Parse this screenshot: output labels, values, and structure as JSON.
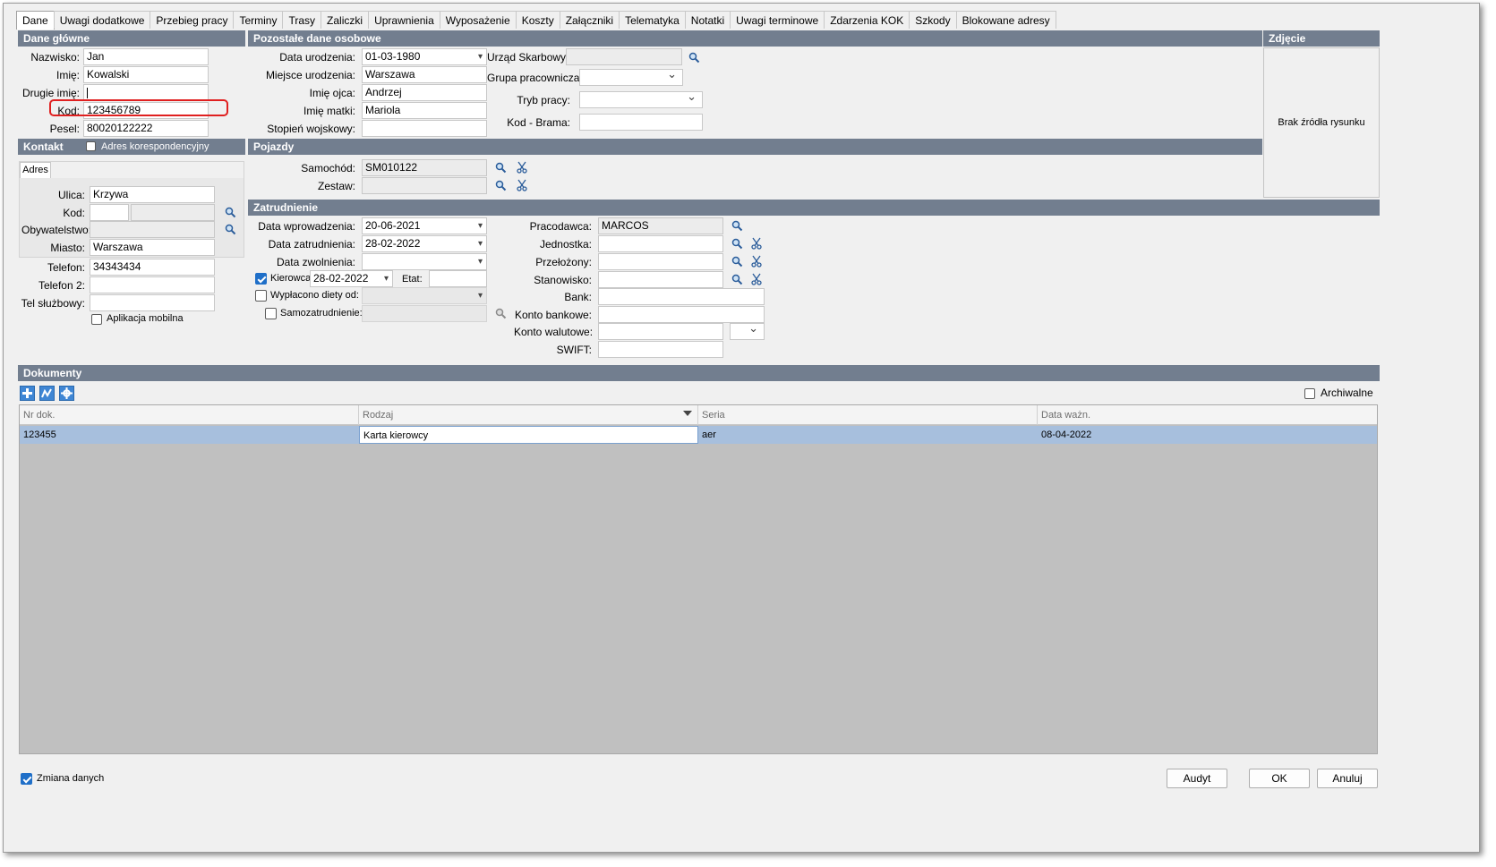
{
  "tabs": [
    "Dane",
    "Uwagi dodatkowe",
    "Przebieg pracy",
    "Terminy",
    "Trasy",
    "Zaliczki",
    "Uprawnienia",
    "Wyposażenie",
    "Koszty",
    "Załączniki",
    "Telematyka",
    "Notatki",
    "Uwagi terminowe",
    "Zdarzenia KOK",
    "Szkody",
    "Blokowane adresy"
  ],
  "sections": {
    "main": "Dane główne",
    "other": "Pozostałe dane osobowe",
    "photo": "Zdjęcie",
    "contact": "Kontakt",
    "vehicles": "Pojazdy",
    "employment": "Zatrudnienie",
    "documents": "Dokumenty"
  },
  "main": {
    "surname_label": "Nazwisko:",
    "surname": "Jan",
    "name_label": "Imię:",
    "name": "Kowalski",
    "second_name_label": "Drugie imię:",
    "second_name": "",
    "code_label": "Kod:",
    "code": "123456789",
    "pesel_label": "Pesel:",
    "pesel": "80020122222"
  },
  "other": {
    "birth_date_label": "Data urodzenia:",
    "birth_date": "01-03-1980",
    "birth_place_label": "Miejsce urodzenia:",
    "birth_place": "Warszawa",
    "father_label": "Imię ojca:",
    "father": "Andrzej",
    "mother_label": "Imię matki:",
    "mother": "Mariola",
    "military_label": "Stopień wojskowy:",
    "military": "",
    "tax_office_label": "Urząd Skarbowy:",
    "tax_office": "",
    "worker_group_label": "Grupa pracownicza:",
    "worker_group": "",
    "work_mode_label": "Tryb pracy:",
    "work_mode": "",
    "gate_code_label": "Kod - Brama:",
    "gate_code": ""
  },
  "photo": {
    "empty_text": "Brak źródła rysunku"
  },
  "contact": {
    "corr_address_label": "Adres korespondencyjny",
    "address_tab": "Adres",
    "street_label": "Ulica:",
    "street": "Krzywa",
    "postal_label": "Kod:",
    "postal": "",
    "postal_city": "",
    "citizenship_label": "Obywatelstwo:",
    "citizenship": "",
    "city_label": "Miasto:",
    "city": "Warszawa",
    "phone_label": "Telefon:",
    "phone": "34343434",
    "phone2_label": "Telefon 2:",
    "phone2": "",
    "work_phone_label": "Tel służbowy:",
    "work_phone": "",
    "mobile_app_label": "Aplikacja mobilna"
  },
  "vehicles": {
    "car_label": "Samochód:",
    "car": "SM010122",
    "set_label": "Zestaw:",
    "set": ""
  },
  "employment": {
    "intro_date_label": "Data wprowadzenia:",
    "intro_date": "20-06-2021",
    "hire_date_label": "Data zatrudnienia:",
    "hire_date": "28-02-2022",
    "release_date_label": "Data zwolnienia:",
    "release_date": "",
    "driver_label": "Kierowca",
    "driver_date": "28-02-2022",
    "etat_label": "Etat:",
    "etat": "",
    "diety_label": "Wypłacono diety od:",
    "diety": "",
    "self_label": "Samozatrudnienie:",
    "self": "",
    "employer_label": "Pracodawca:",
    "employer": "MARCOS",
    "unit_label": "Jednostka:",
    "unit": "",
    "supervisor_label": "Przełożony:",
    "supervisor": "",
    "position_label": "Stanowisko:",
    "position": "",
    "bank_label": "Bank:",
    "bank": "",
    "account_label": "Konto bankowe:",
    "account": "",
    "fx_account_label": "Konto walutowe:",
    "fx_account": "",
    "currency": "",
    "swift_label": "SWIFT:",
    "swift": ""
  },
  "documents": {
    "archived_label": "Archiwalne",
    "columns": [
      "Nr dok.",
      "Rodzaj",
      "Seria",
      "Data ważn."
    ],
    "rows": [
      {
        "nr": "123455",
        "rodzaj": "Karta kierowcy",
        "seria": "aer",
        "data": "08-04-2022"
      }
    ]
  },
  "footer": {
    "change_label": "Zmiana danych",
    "audit": "Audyt",
    "ok": "OK",
    "cancel": "Anuluj"
  },
  "colors": {
    "section_header": "#727e8f",
    "row_selected": "#a7bfdd",
    "checkbox_on": "#1f6fc8",
    "highlight_border": "#e02020"
  }
}
